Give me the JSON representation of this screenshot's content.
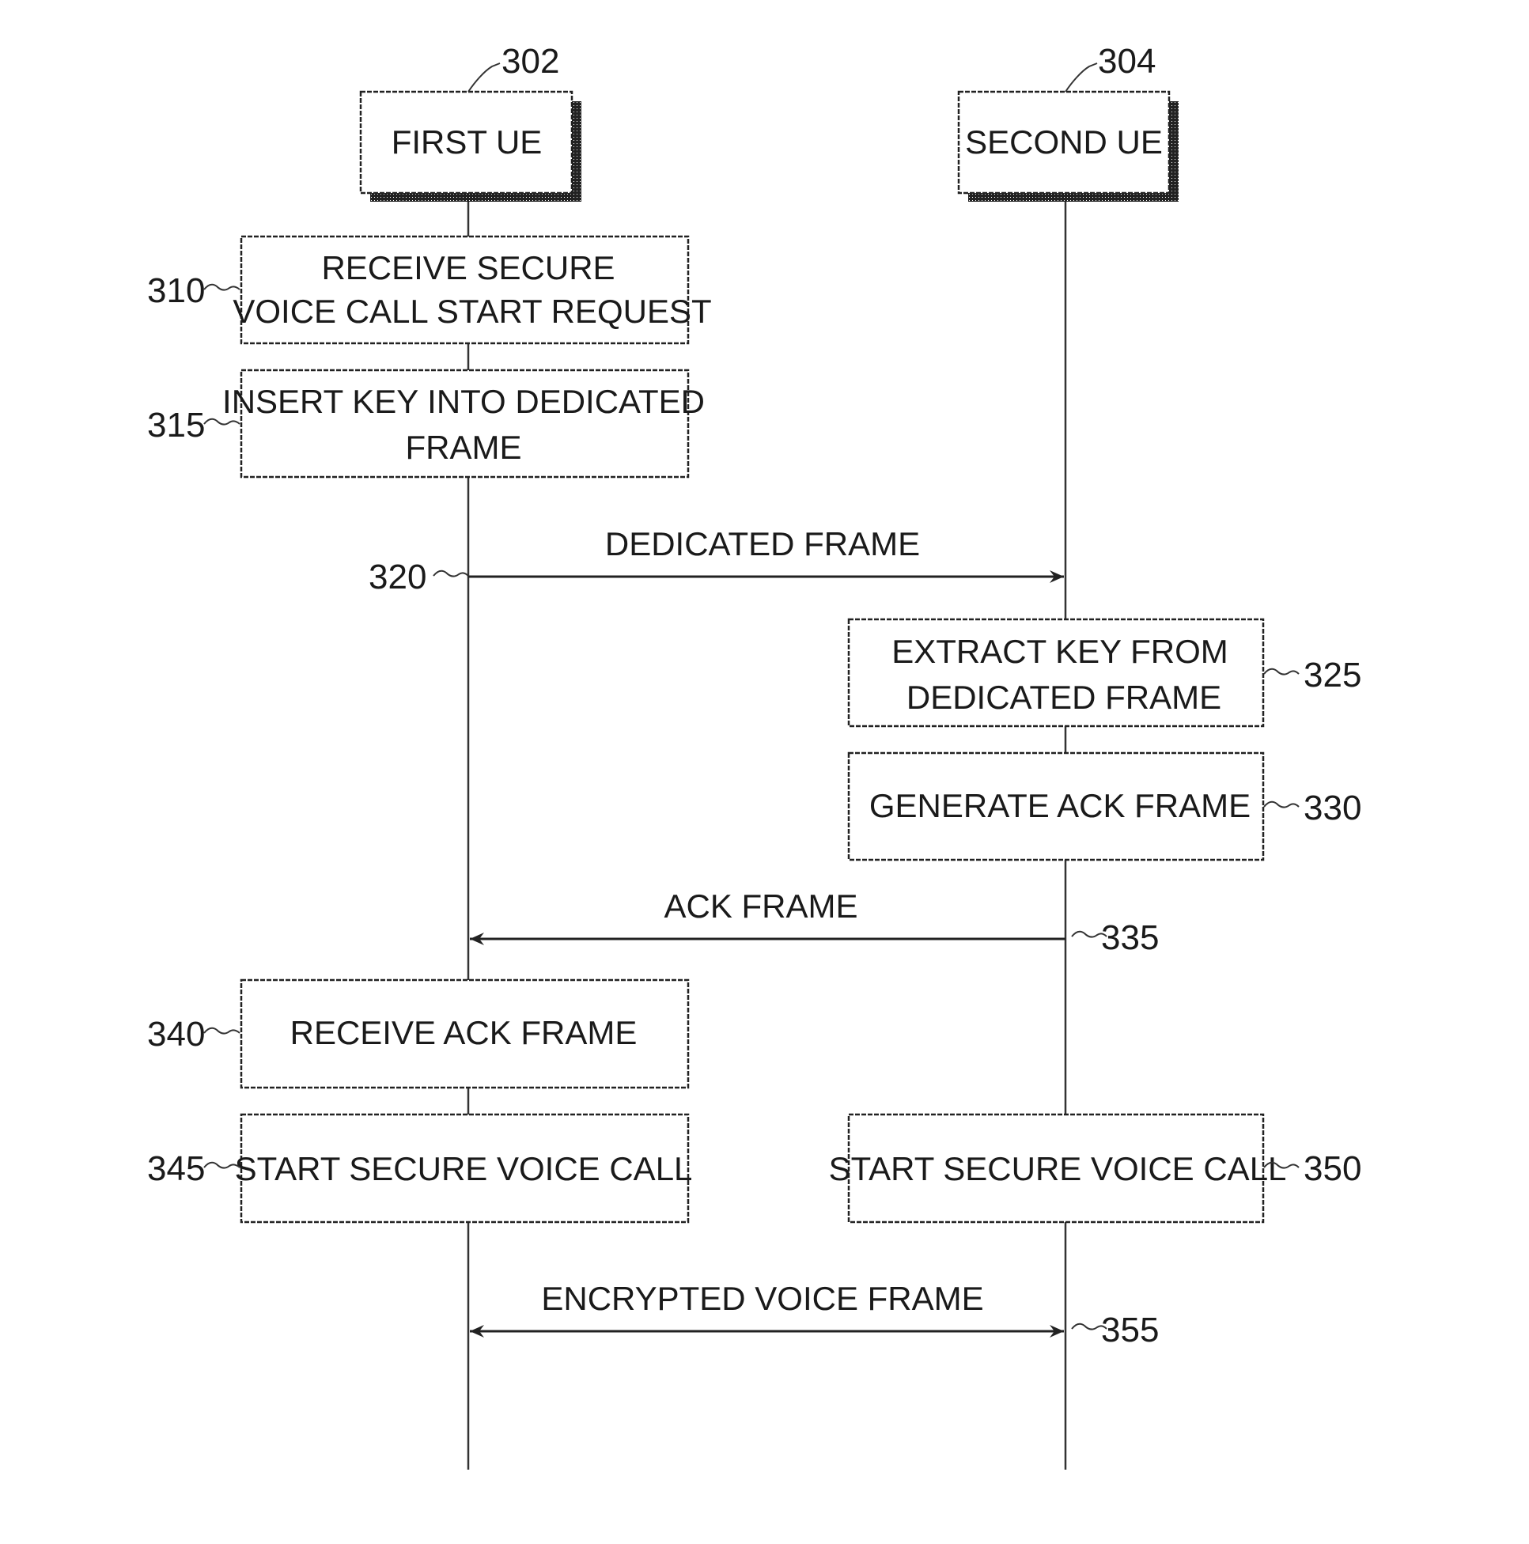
{
  "diagram": {
    "type": "sequence",
    "participants": [
      {
        "id": "first",
        "ref": "302",
        "label": "FIRST UE"
      },
      {
        "id": "second",
        "ref": "304",
        "label": "SECOND UE"
      }
    ],
    "steps": [
      {
        "ref": "310",
        "kind": "action",
        "actor": "first",
        "lines": [
          "RECEIVE SECURE",
          "VOICE CALL START REQUEST"
        ]
      },
      {
        "ref": "315",
        "kind": "action",
        "actor": "first",
        "lines": [
          "INSERT KEY INTO DEDICATED",
          "FRAME"
        ]
      },
      {
        "ref": "320",
        "kind": "message",
        "from": "first",
        "to": "second",
        "label": "DEDICATED FRAME"
      },
      {
        "ref": "325",
        "kind": "action",
        "actor": "second",
        "lines": [
          "EXTRACT KEY FROM",
          "DEDICATED FRAME"
        ]
      },
      {
        "ref": "330",
        "kind": "action",
        "actor": "second",
        "lines": [
          "GENERATE ACK FRAME"
        ]
      },
      {
        "ref": "335",
        "kind": "message",
        "from": "second",
        "to": "first",
        "label": "ACK FRAME"
      },
      {
        "ref": "340",
        "kind": "action",
        "actor": "first",
        "lines": [
          "RECEIVE ACK FRAME"
        ]
      },
      {
        "ref": "345",
        "kind": "action",
        "actor": "first",
        "lines": [
          "START SECURE VOICE CALL"
        ]
      },
      {
        "ref": "350",
        "kind": "action",
        "actor": "second",
        "lines": [
          "START SECURE VOICE CALL"
        ]
      },
      {
        "ref": "355",
        "kind": "message",
        "from": "first",
        "to": "second",
        "bidirectional": true,
        "label": "ENCRYPTED VOICE FRAME"
      }
    ]
  }
}
